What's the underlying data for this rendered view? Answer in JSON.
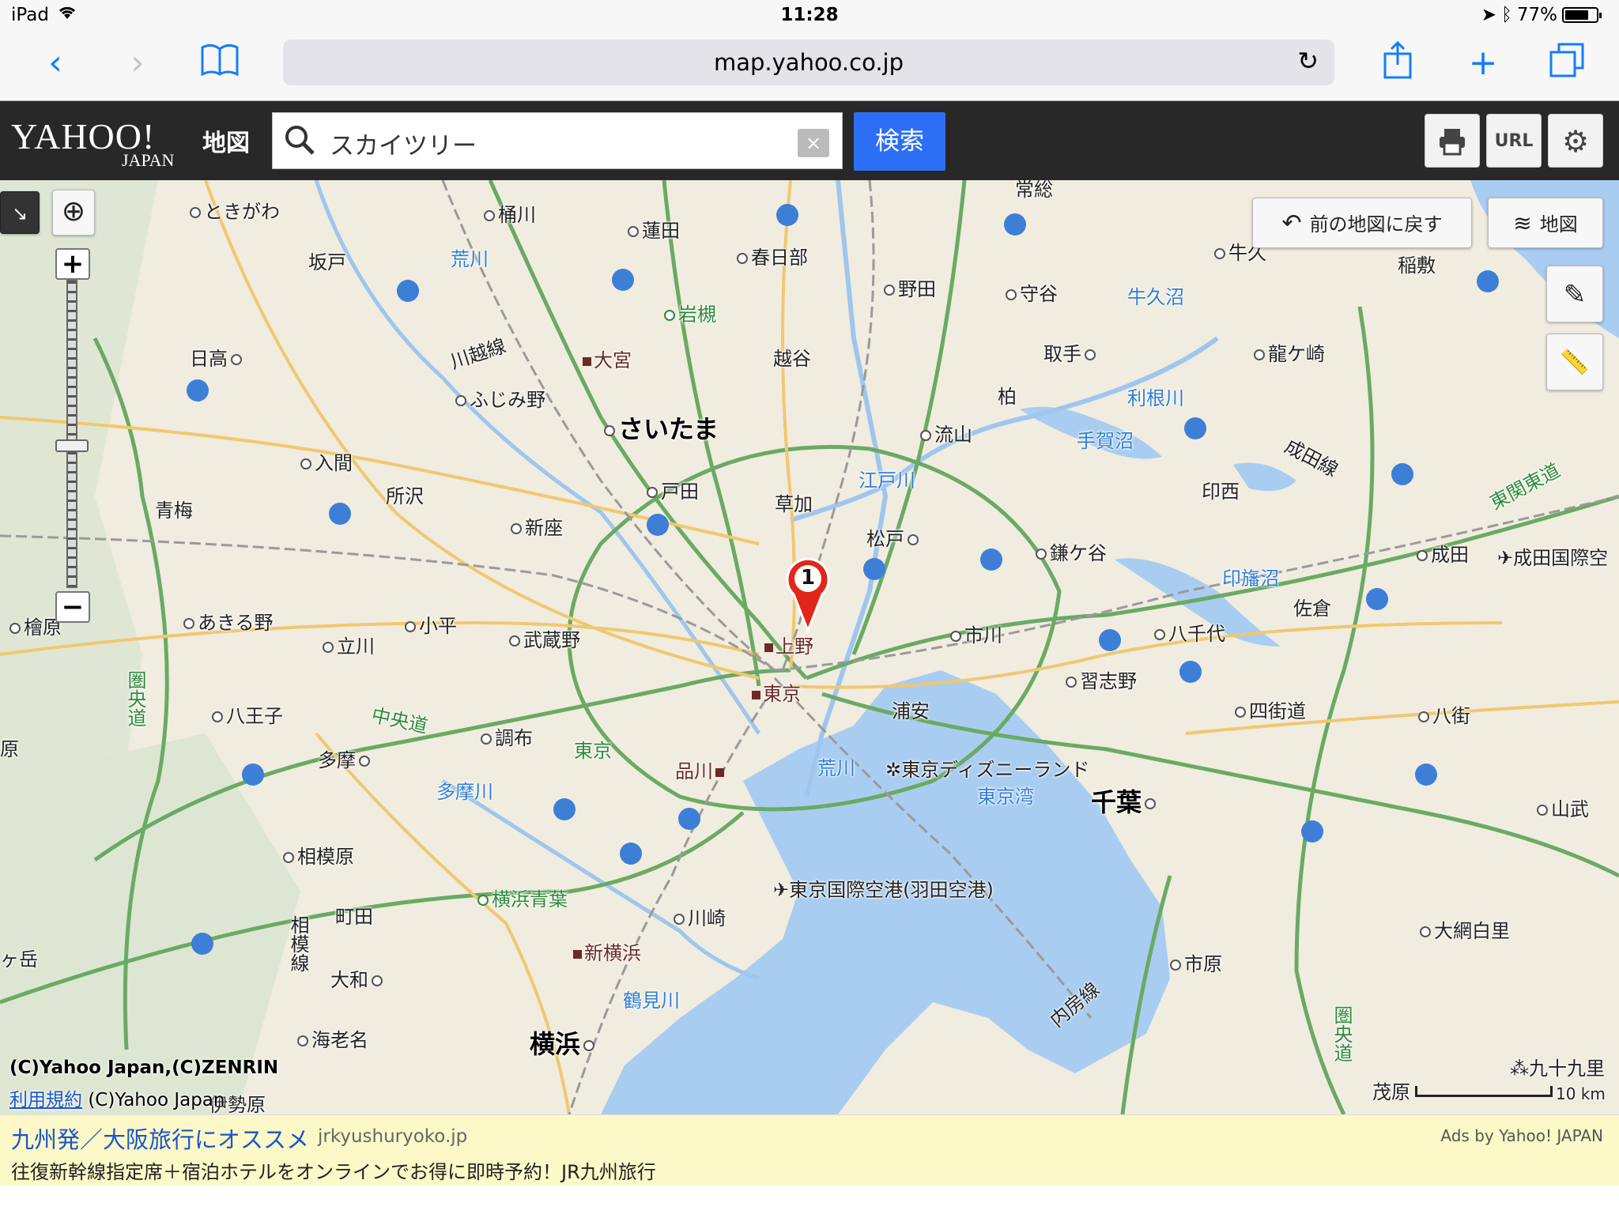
{
  "status": {
    "carrier": "iPad",
    "time": "11:28",
    "battery": "77%",
    "battery_level": 0.77
  },
  "browser": {
    "url": "map.yahoo.co.jp"
  },
  "header": {
    "logo_main": "YAHOO!",
    "logo_sub": "JAPAN",
    "logo_service": "地図",
    "search_value": "スカイツリー",
    "clear_label": "×",
    "search_button": "検索",
    "url_button": "URL"
  },
  "map_controls": {
    "back_to_previous": "前の地図に戻す",
    "layer_button": "地図"
  },
  "map": {
    "marker_number": "1",
    "scale_label": "10 km",
    "labels": {
      "tokigawa": "ときがわ",
      "okegawa": "桶川",
      "hasuda": "蓮田",
      "kasukabe": "春日部",
      "noda": "野田",
      "moriya": "守谷",
      "ushikunuma": "牛久沼",
      "ushiku": "牛久",
      "inashiki": "稲敷",
      "sakado": "坂戸",
      "arakawa_n": "荒川",
      "iwatsuki": "岩槻",
      "hidaka": "日高",
      "kawagoe_line": "川越線",
      "omiya": "大宮",
      "koshigaya": "越谷",
      "toride": "取手",
      "ryugasaki": "龍ケ崎",
      "fujimino": "ふじみ野",
      "saitama": "さいたま",
      "kashiwa": "柏",
      "tonegawa": "利根川",
      "nagareyama": "流山",
      "iruma": "入間",
      "tegonuma": "手賀沼",
      "narita_line": "成田線",
      "tokorozawa": "所沢",
      "toda": "戸田",
      "soka": "草加",
      "edogawa": "江戸川",
      "inzai": "印西",
      "ome": "青梅",
      "niiza": "新座",
      "matsudo": "松戸",
      "kamagaya": "鎌ケ谷",
      "narita": "成田",
      "narita_airport": "成田国際空",
      "higashikanto": "東関東道",
      "inbanuma": "印旛沼",
      "sakura": "佐倉",
      "hinohara": "檜原",
      "akiruno": "あきる野",
      "kodaira": "小平",
      "musashino": "武蔵野",
      "tachikawa": "立川",
      "ueno": "上野",
      "ichikawa": "市川",
      "yachiyo": "八千代",
      "ken_o": "圏央道",
      "tokyo": "東京",
      "narashino": "習志野",
      "hachioji": "八王子",
      "chuo": "中央道",
      "chofu": "調布",
      "urayasu": "浦安",
      "yotsukaido": "四街道",
      "yachimata": "八街",
      "tama": "多摩",
      "tokyo_park": "東京",
      "shinagawa": "品川",
      "arakawa_s": "荒川",
      "disney": "東京ディズニーランド",
      "tokyowan": "東京湾",
      "chiba": "千葉",
      "tamagawa": "多摩川",
      "sammu": "山武",
      "sagamihara": "相模原",
      "haneda": "東京国際空港(羽田空港)",
      "yokohama_aoba": "横浜青葉",
      "machida": "町田",
      "kawasaki": "川崎",
      "oamishirasato": "大網白里",
      "sagami_line": "相模線",
      "shinyokohama": "新横浜",
      "ichihara": "市原",
      "uchibo": "内房線",
      "yamato": "大和",
      "tsurumi": "鶴見川",
      "ebina": "海老名",
      "yokohama": "横浜",
      "kujukuri": "九十九里",
      "mobara": "茂原",
      "isehara": "伊勢原",
      "hitachi": "常総",
      "take": "ヶ岳",
      "hara": "原"
    },
    "copyright": "(C)Yahoo Japan,(C)ZENRIN",
    "terms": "利用規約",
    "copyright2": "(C)Yahoo Japan"
  },
  "ad": {
    "title": "九州発／大阪旅行にオススメ",
    "domain": "jrkyushuryoko.jp",
    "by": "Ads by Yahoo! JAPAN",
    "desc": "往復新幹線指定席＋宿泊ホテルをオンラインでお得に即時予約！JR九州旅行"
  },
  "colors": {
    "accent": "#147efb",
    "search_btn": "#2c6ff5",
    "header_bg": "#282828",
    "water": "#a9cdf0",
    "expressway": "#6aaa64",
    "road": "#f0c870",
    "land": "#f0ecdf"
  }
}
